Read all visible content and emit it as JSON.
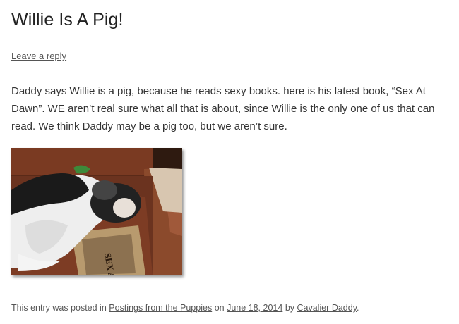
{
  "post": {
    "title": "Willie Is A Pig!",
    "reply_link": "Leave a reply",
    "body": "Daddy says Willie is a pig, because he reads sexy books. here is his latest book, “Sex At Dawn”. WE aren’t real sure what all that is about, since Willie is the only one of us that can read. We think Daddy may be a pig too, but we aren’t sure.",
    "photo": {
      "book_text": "SEX AT DAWN"
    }
  },
  "meta": {
    "prefix": "This entry was posted in",
    "category": "Postings from the Puppies",
    "on_word": "on",
    "date": "June 18, 2014",
    "by_word": "by",
    "author": "Cavalier Daddy",
    "suffix": "."
  }
}
